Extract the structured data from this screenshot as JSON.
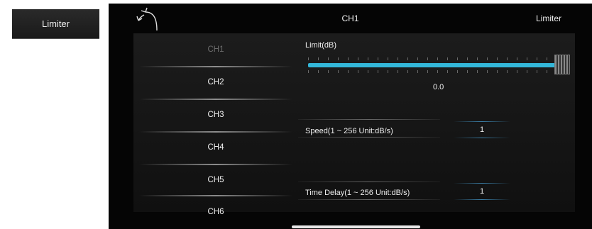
{
  "side_button": {
    "label": "Limiter"
  },
  "topbar": {
    "title": "CH1",
    "right_label": "Limiter"
  },
  "channels": [
    {
      "label": "CH1"
    },
    {
      "label": "CH2"
    },
    {
      "label": "CH3"
    },
    {
      "label": "CH4"
    },
    {
      "label": "CH5"
    },
    {
      "label": "CH6"
    }
  ],
  "selected_channel": "CH1",
  "limit": {
    "label": "Limit(dB)",
    "value": "0.0",
    "slider_fraction": 1.0
  },
  "speed": {
    "label": "Speed(1 ~ 256 Unit:dB/s)",
    "value": "1"
  },
  "time_delay": {
    "label": "Time Delay(1 ~ 256 Unit:dB/s)",
    "value": "1"
  },
  "colors": {
    "accent": "#33b7d9",
    "background": "#050505"
  },
  "icons": {
    "back": "back-arrow-icon"
  }
}
